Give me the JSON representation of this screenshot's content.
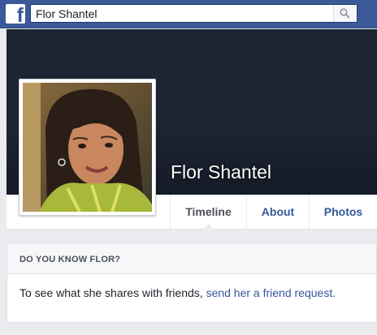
{
  "topbar": {
    "logo_icon": "facebook-f-icon",
    "search_value": "Flor Shantel",
    "search_icon": "search-icon",
    "brand_color": "#3b5998"
  },
  "profile": {
    "name": "Flor Shantel",
    "tabs": [
      {
        "label": "Timeline",
        "active": true
      },
      {
        "label": "About",
        "active": false
      },
      {
        "label": "Photos",
        "active": false
      }
    ]
  },
  "know_card": {
    "title": "DO YOU KNOW FLOR?",
    "body_text": "To see what she shares with friends, ",
    "link_text": "send her a friend request."
  },
  "colors": {
    "cover": "#1d2433",
    "link": "#365899",
    "page_bg": "#e9ebee"
  }
}
